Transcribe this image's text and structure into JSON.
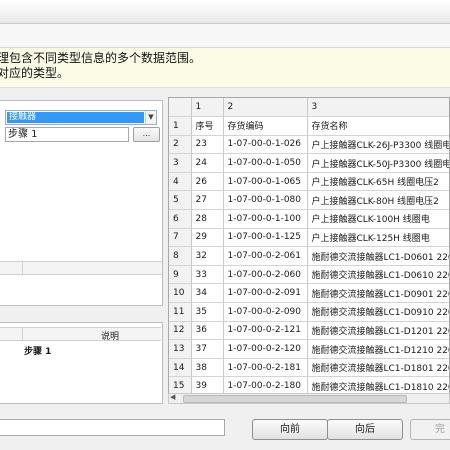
{
  "hint": {
    "line1": "理包含不同类型信息的多个数据范围。",
    "line2": "对应的类型。"
  },
  "left": {
    "type_select": "接触器",
    "step_value": "步骤 1",
    "browse_label": "...",
    "list_header": "说明",
    "list_item": "步骤 1"
  },
  "grid": {
    "columns": [
      "1",
      "2",
      "3"
    ],
    "rows": [
      {
        "n": "1",
        "a": "序号",
        "b": "存货编码",
        "c": "存货名称"
      },
      {
        "n": "2",
        "a": "23",
        "b": "1-07-00-0-1-026",
        "c": "户上接触器CLK-26J-P3300   线圈电"
      },
      {
        "n": "3",
        "a": "24",
        "b": "1-07-00-0-1-050",
        "c": "户上接触器CLK-50J-P3300   线圈电"
      },
      {
        "n": "4",
        "a": "26",
        "b": "1-07-00-0-1-065",
        "c": "户上接触器CLK-65H     线圈电压2"
      },
      {
        "n": "5",
        "a": "27",
        "b": "1-07-00-0-1-080",
        "c": "户上接触器CLK-80H     线圈电压2"
      },
      {
        "n": "6",
        "a": "28",
        "b": "1-07-00-0-1-100",
        "c": "户上接触器CLK-100H     线圈电"
      },
      {
        "n": "7",
        "a": "29",
        "b": "1-07-00-0-1-125",
        "c": "户上接触器CLK-125H     线圈电"
      },
      {
        "n": "8",
        "a": "32",
        "b": "1-07-00-0-2-061",
        "c": "施耐德交流接触器LC1-D0601 220"
      },
      {
        "n": "9",
        "a": "33",
        "b": "1-07-00-0-2-060",
        "c": "施耐德交流接触器LC1-D0610 220"
      },
      {
        "n": "10",
        "a": "34",
        "b": "1-07-00-0-2-091",
        "c": "施耐德交流接触器LC1-D0901 220"
      },
      {
        "n": "11",
        "a": "35",
        "b": "1-07-00-0-2-090",
        "c": "施耐德交流接触器LC1-D0910 220"
      },
      {
        "n": "12",
        "a": "36",
        "b": "1-07-00-0-2-121",
        "c": "施耐德交流接触器LC1-D1201 220"
      },
      {
        "n": "13",
        "a": "37",
        "b": "1-07-00-0-2-120",
        "c": "施耐德交流接触器LC1-D1210 220"
      },
      {
        "n": "14",
        "a": "38",
        "b": "1-07-00-0-2-181",
        "c": "施耐德交流接触器LC1-D1801 220"
      },
      {
        "n": "15",
        "a": "39",
        "b": "1-07-00-0-2-180",
        "c": "施耐德交流接触器LC1-D1810 220"
      }
    ]
  },
  "buttons": {
    "prev": "向前",
    "next": "向后",
    "finish": "完"
  }
}
